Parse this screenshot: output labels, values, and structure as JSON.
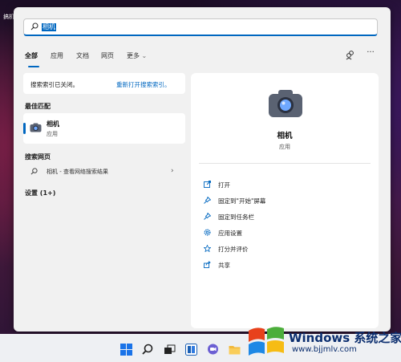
{
  "desktop": {
    "corner_text": "搞机"
  },
  "search": {
    "value": "相机"
  },
  "tabs": [
    {
      "label": "全部",
      "active": true
    },
    {
      "label": "应用"
    },
    {
      "label": "文档"
    },
    {
      "label": "网页"
    },
    {
      "label": "更多"
    }
  ],
  "notice": {
    "text": "搜索索引已关闭。",
    "link": "重新打开搜索索引。"
  },
  "left": {
    "best_match_heading": "最佳匹配",
    "best_match": {
      "title": "相机",
      "subtitle": "应用"
    },
    "web_heading": "搜索网页",
    "web_result": "相机 - 查看网络搜索结果",
    "settings_heading": "设置 (1+)"
  },
  "right": {
    "app_name": "相机",
    "app_type": "应用",
    "actions": [
      {
        "label": "打开",
        "icon": "open-icon"
      },
      {
        "label": "固定到\"开始\"屏幕",
        "icon": "pin-icon"
      },
      {
        "label": "固定到任务栏",
        "icon": "pin-icon"
      },
      {
        "label": "应用设置",
        "icon": "gear-icon"
      },
      {
        "label": "打分并评价",
        "icon": "star-icon"
      },
      {
        "label": "共享",
        "icon": "share-icon"
      }
    ]
  },
  "taskbar": {
    "icons": [
      "windows-start-icon",
      "search-icon",
      "task-view-icon",
      "widgets-icon",
      "chat-icon",
      "file-explorer-icon"
    ]
  },
  "watermark": {
    "brand": "Windows 系统之家",
    "url": "www.bjjmlv.com"
  },
  "colors": {
    "accent": "#0067c0",
    "panel": "#f1f1f1",
    "card": "#ffffff"
  }
}
